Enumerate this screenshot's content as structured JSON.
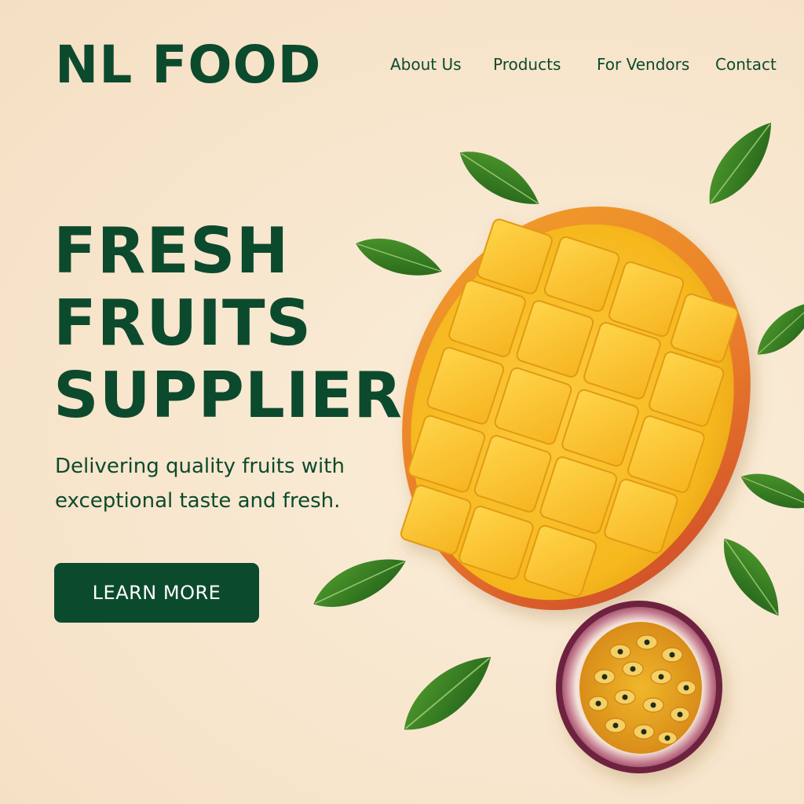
{
  "brand": {
    "name": "NL FOOD"
  },
  "nav": {
    "items": [
      {
        "label": "About Us"
      },
      {
        "label": "Products"
      },
      {
        "label": "For Vendors"
      },
      {
        "label": "Contact"
      }
    ]
  },
  "hero": {
    "headline_lines": [
      "FRESH",
      "FRUITS",
      "SUPPLIER"
    ],
    "tagline_lines": [
      "Delivering quality fruits with",
      "exceptional taste and fresh."
    ],
    "cta_label": "LEARN MORE"
  },
  "colors": {
    "background": "#f7e6cc",
    "brand_green": "#0c4a2e",
    "leaf_green": "#2f7a1f",
    "mango_flesh": "#f6b81e",
    "mango_skin": "#d9542a",
    "passion_fruit_skin": "#7b2f4a"
  },
  "illustration": {
    "items": [
      "mango-icon",
      "passion-fruit-icon",
      "leaf-icon"
    ]
  }
}
